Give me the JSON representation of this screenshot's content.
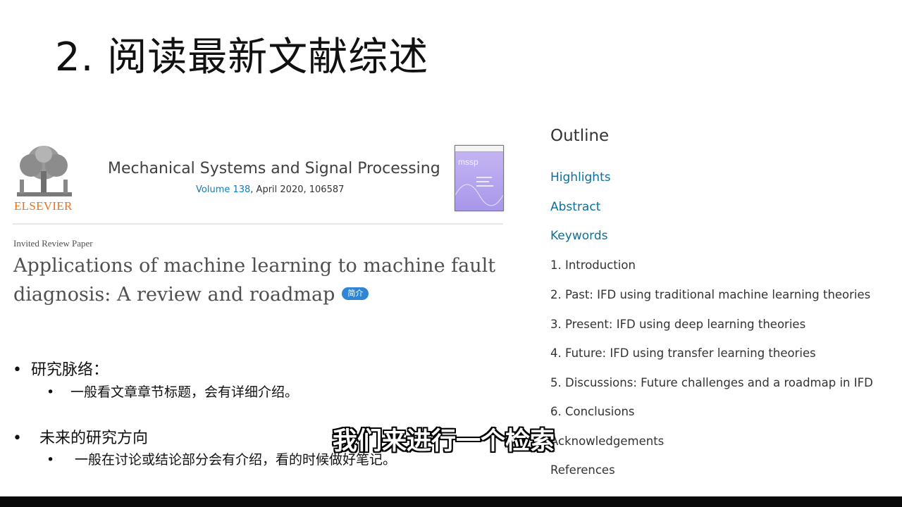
{
  "slide": {
    "title": "2. 阅读最新文献综述"
  },
  "journal": {
    "publisher": "ELSEVIER",
    "name": "Mechanical Systems and Signal Processing",
    "volume_link": "Volume 138",
    "issue_rest": ", April 2020, 106587",
    "cover_text": "mssp"
  },
  "article": {
    "type": "Invited Review Paper",
    "title": "Applications of machine learning to machine fault diagnosis: A review and roadmap",
    "badge": "简介"
  },
  "bullets": [
    {
      "text": "研究脉络：",
      "sub": "一般看文章章节标题，会有详细介绍。"
    },
    {
      "text": "未来的研究方向",
      "sub": "一般在讨论或结论部分会有介绍，看的时候做好笔记。"
    }
  ],
  "outline": {
    "heading": "Outline",
    "items": [
      "Highlights",
      "Abstract",
      "Keywords",
      "1. Introduction",
      "2. Past: IFD using traditional machine learning theories",
      "3. Present: IFD using deep learning theories",
      "4. Future: IFD using transfer learning theories",
      "5. Discussions: Future challenges and a roadmap in IFD",
      "6. Conclusions",
      "Acknowledgements",
      "References"
    ]
  },
  "subtitle": "我们来进行一个检索",
  "colors": {
    "link": "#0c6f99",
    "publisher": "#e9711c",
    "badge": "#2f86d4"
  }
}
